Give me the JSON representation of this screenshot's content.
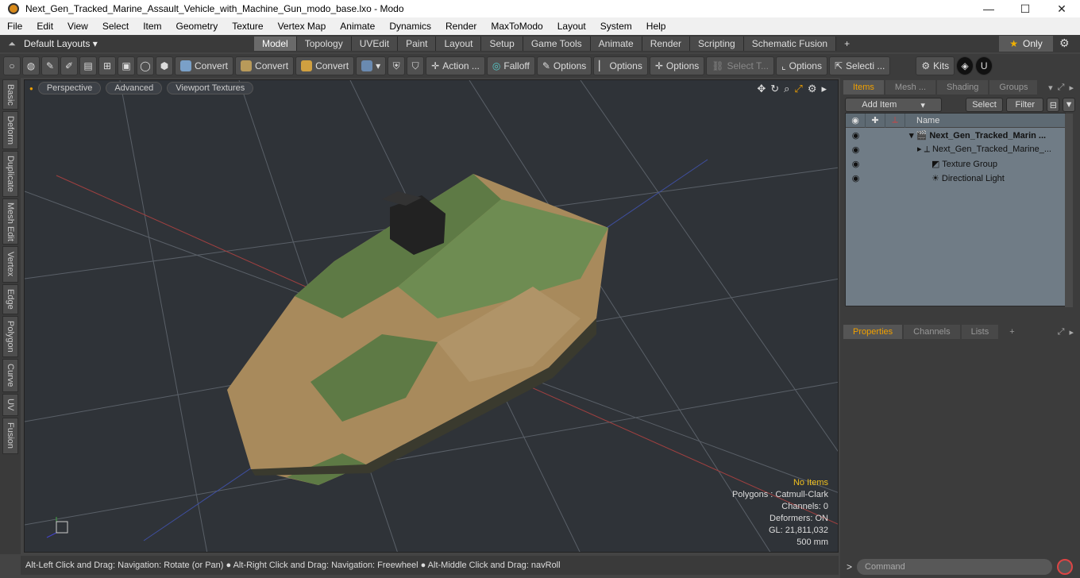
{
  "window": {
    "title": "Next_Gen_Tracked_Marine_Assault_Vehicle_with_Machine_Gun_modo_base.lxo - Modo",
    "min": "—",
    "max": "☐",
    "close": "✕"
  },
  "menu": [
    "File",
    "Edit",
    "View",
    "Select",
    "Item",
    "Geometry",
    "Texture",
    "Vertex Map",
    "Animate",
    "Dynamics",
    "Render",
    "MaxToModo",
    "Layout",
    "System",
    "Help"
  ],
  "layoutbar": {
    "default_layouts": "Default Layouts ▾",
    "tabs": [
      "Model",
      "Topology",
      "UVEdit",
      "Paint",
      "Layout",
      "Setup",
      "Game Tools",
      "Animate",
      "Render",
      "Scripting",
      "Schematic Fusion"
    ],
    "active": "Model",
    "plus": "+",
    "only": "Only"
  },
  "toolbar": {
    "convert1": "Convert",
    "convert2": "Convert",
    "convert3": "Convert",
    "action": "Action ...",
    "falloff": "Falloff",
    "options1": "Options",
    "options2": "Options",
    "options3": "Options",
    "select_t": "Select T...",
    "options4": "Options",
    "selecti": "Selecti ...",
    "kits": "Kits"
  },
  "lefttabs": [
    "Basic",
    "Deform",
    "Duplicate",
    "Mesh Edit",
    "Vertex",
    "Edge",
    "Polygon",
    "Curve",
    "UV",
    "Fusion"
  ],
  "viewport": {
    "perspective": "Perspective",
    "advanced": "Advanced",
    "textures": "Viewport Textures"
  },
  "info": {
    "no_items": "No Items",
    "polygons": "Polygons : Catmull-Clark",
    "channels": "Channels: 0",
    "deformers": "Deformers: ON",
    "gl": "GL: 21,811,032",
    "scale": "500 mm"
  },
  "status": "Alt-Left Click and Drag: Navigation: Rotate (or Pan) ● Alt-Right Click and Drag: Navigation: Freewheel ● Alt-Middle Click and Drag: navRoll",
  "rpanel": {
    "tabs": [
      "Items",
      "Mesh ...",
      "Shading",
      "Groups"
    ],
    "add_item": "Add Item",
    "select": "Select",
    "filter": "Filter",
    "name_col": "Name",
    "tree": [
      "Next_Gen_Tracked_Marin ...",
      "Next_Gen_Tracked_Marine_...",
      "Texture Group",
      "Directional Light"
    ],
    "prop_tabs": [
      "Properties",
      "Channels",
      "Lists"
    ],
    "command_placeholder": "Command"
  },
  "colors": {
    "accent": "#f0a000",
    "viewport_bg": "#2f3338",
    "tree_bg": "#707c86"
  }
}
